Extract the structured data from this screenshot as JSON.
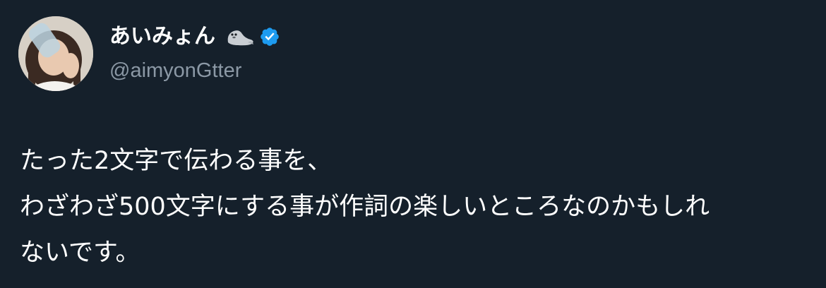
{
  "author": {
    "display_name": "あいみょん",
    "handle": "@aimyonGtter",
    "emoji_icon": "seal-icon",
    "verified_icon": "verified-badge-icon",
    "verified_color": "#1d9bf0"
  },
  "tweet": {
    "lines": [
      "たった2文字で伝わる事を、",
      "わざわざ500文字にする事が作詞の楽しいところなのかもしれ",
      "ないです。"
    ]
  },
  "colors": {
    "background": "#15202b",
    "text_primary": "#ffffff",
    "text_secondary": "#8b98a5"
  }
}
